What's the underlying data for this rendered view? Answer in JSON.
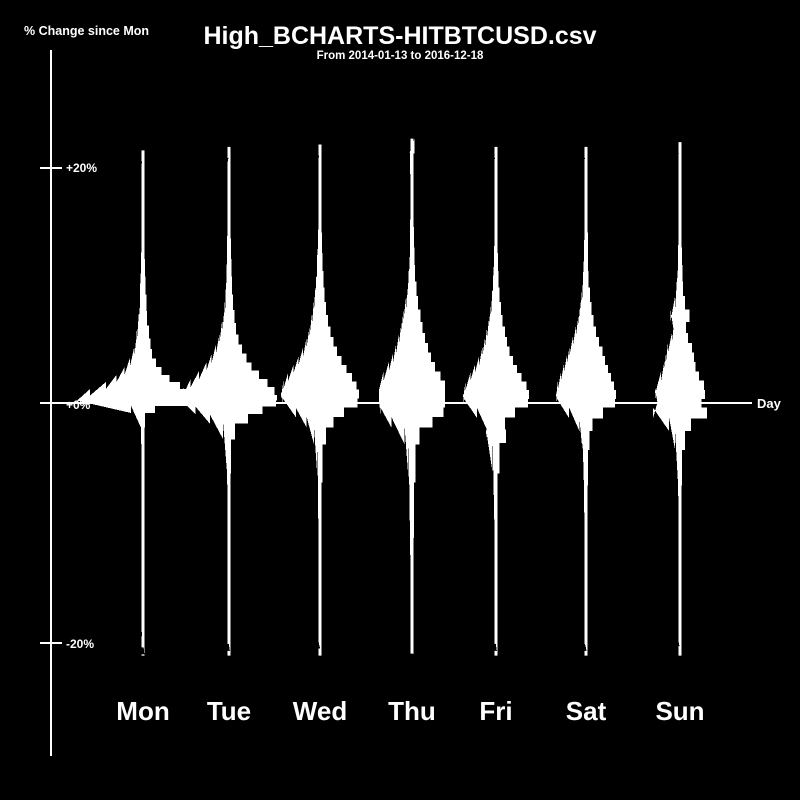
{
  "chart_data": {
    "type": "violin",
    "title": "High_BCHARTS-HITBTCUSD.csv",
    "subtitle": "From 2014-01-13 to 2016-12-18",
    "ylabel": "% Change since Mon",
    "xlabel": "Day",
    "ylim": [
      -24,
      24
    ],
    "yticks": [
      20,
      0,
      -20
    ],
    "ytick_labels": [
      "+20%",
      "+0%",
      "-20%"
    ],
    "grid": false,
    "legend": null,
    "background_color": "#000000",
    "foreground_color": "#ffffff",
    "categories": [
      "Mon",
      "Tue",
      "Wed",
      "Thu",
      "Fri",
      "Sat",
      "Sun"
    ],
    "series": [
      {
        "name": "Mon",
        "center_x": 143,
        "whisker_top": 21.5,
        "whisker_bottom": -21.5,
        "median": 0.0,
        "max_halfwidth_pct": 11.0,
        "density": [
          {
            "v": 21.5,
            "w": 0.02
          },
          {
            "v": 19.0,
            "w": 0.02
          },
          {
            "v": 17.0,
            "w": 0.02
          },
          {
            "v": 15.0,
            "w": 0.02
          },
          {
            "v": 13.0,
            "w": 0.02
          },
          {
            "v": 11.5,
            "w": 0.03
          },
          {
            "v": 10.0,
            "w": 0.04
          },
          {
            "v": 8.5,
            "w": 0.05
          },
          {
            "v": 7.2,
            "w": 0.06
          },
          {
            "v": 6.0,
            "w": 0.09
          },
          {
            "v": 5.0,
            "w": 0.11
          },
          {
            "v": 4.2,
            "w": 0.14
          },
          {
            "v": 3.4,
            "w": 0.2
          },
          {
            "v": 2.7,
            "w": 0.28
          },
          {
            "v": 2.1,
            "w": 0.4
          },
          {
            "v": 1.5,
            "w": 0.56
          },
          {
            "v": 0.9,
            "w": 0.8
          },
          {
            "v": 0.4,
            "w": 1.0
          },
          {
            "v": 0.0,
            "w": 1.0
          },
          {
            "v": -0.5,
            "w": 0.18
          },
          {
            "v": -1.2,
            "w": 0.03
          },
          {
            "v": -3.0,
            "w": 0.02
          },
          {
            "v": -7.0,
            "w": 0.02
          },
          {
            "v": -12.0,
            "w": 0.02
          },
          {
            "v": -17.0,
            "w": 0.02
          },
          {
            "v": -21.5,
            "w": 0.02
          }
        ]
      },
      {
        "name": "Tue",
        "center_x": 229,
        "whisker_top": 21.8,
        "whisker_bottom": -21.5,
        "median": 0.3,
        "max_halfwidth_pct": 8.0,
        "density": [
          {
            "v": 21.8,
            "w": 0.03
          },
          {
            "v": 19.0,
            "w": 0.03
          },
          {
            "v": 17.0,
            "w": 0.03
          },
          {
            "v": 15.0,
            "w": 0.03
          },
          {
            "v": 13.0,
            "w": 0.04
          },
          {
            "v": 11.5,
            "w": 0.05
          },
          {
            "v": 10.0,
            "w": 0.06
          },
          {
            "v": 8.5,
            "w": 0.08
          },
          {
            "v": 7.3,
            "w": 0.11
          },
          {
            "v": 6.3,
            "w": 0.15
          },
          {
            "v": 5.4,
            "w": 0.2
          },
          {
            "v": 4.6,
            "w": 0.27
          },
          {
            "v": 3.8,
            "w": 0.36
          },
          {
            "v": 3.1,
            "w": 0.47
          },
          {
            "v": 2.4,
            "w": 0.62
          },
          {
            "v": 1.7,
            "w": 0.8
          },
          {
            "v": 1.0,
            "w": 0.95
          },
          {
            "v": 0.4,
            "w": 1.0
          },
          {
            "v": 0.0,
            "w": 0.98
          },
          {
            "v": -0.6,
            "w": 0.7
          },
          {
            "v": -1.3,
            "w": 0.4
          },
          {
            "v": -2.2,
            "w": 0.12
          },
          {
            "v": -4.0,
            "w": 0.04
          },
          {
            "v": -8.0,
            "w": 0.03
          },
          {
            "v": -13.0,
            "w": 0.03
          },
          {
            "v": -18.0,
            "w": 0.03
          },
          {
            "v": -21.5,
            "w": 0.03
          }
        ]
      },
      {
        "name": "Wed",
        "center_x": 320,
        "whisker_top": 22.0,
        "whisker_bottom": -21.5,
        "median": 0.2,
        "max_halfwidth_pct": 6.5,
        "density": [
          {
            "v": 22.0,
            "w": 0.04
          },
          {
            "v": 19.5,
            "w": 0.04
          },
          {
            "v": 17.5,
            "w": 0.04
          },
          {
            "v": 15.5,
            "w": 0.04
          },
          {
            "v": 13.5,
            "w": 0.05
          },
          {
            "v": 12.0,
            "w": 0.07
          },
          {
            "v": 10.5,
            "w": 0.09
          },
          {
            "v": 9.2,
            "w": 0.12
          },
          {
            "v": 8.0,
            "w": 0.16
          },
          {
            "v": 7.0,
            "w": 0.21
          },
          {
            "v": 6.0,
            "w": 0.27
          },
          {
            "v": 5.2,
            "w": 0.34
          },
          {
            "v": 4.4,
            "w": 0.43
          },
          {
            "v": 3.6,
            "w": 0.55
          },
          {
            "v": 2.9,
            "w": 0.68
          },
          {
            "v": 2.2,
            "w": 0.82
          },
          {
            "v": 1.5,
            "w": 0.94
          },
          {
            "v": 0.8,
            "w": 1.0
          },
          {
            "v": 0.0,
            "w": 0.96
          },
          {
            "v": -0.8,
            "w": 0.62
          },
          {
            "v": -1.6,
            "w": 0.34
          },
          {
            "v": -2.6,
            "w": 0.15
          },
          {
            "v": -4.5,
            "w": 0.06
          },
          {
            "v": -9.0,
            "w": 0.04
          },
          {
            "v": -14.0,
            "w": 0.04
          },
          {
            "v": -19.0,
            "w": 0.04
          },
          {
            "v": -21.5,
            "w": 0.04
          }
        ]
      },
      {
        "name": "Thu",
        "center_x": 412,
        "whisker_top": 22.5,
        "whisker_bottom": -21.5,
        "median": 0.0,
        "max_halfwidth_pct": 5.5,
        "density": [
          {
            "v": 22.5,
            "w": 0.08
          },
          {
            "v": 20.0,
            "w": 0.05
          },
          {
            "v": 18.0,
            "w": 0.05
          },
          {
            "v": 16.0,
            "w": 0.05
          },
          {
            "v": 14.0,
            "w": 0.06
          },
          {
            "v": 12.5,
            "w": 0.07
          },
          {
            "v": 11.0,
            "w": 0.09
          },
          {
            "v": 9.7,
            "w": 0.13
          },
          {
            "v": 8.5,
            "w": 0.18
          },
          {
            "v": 7.4,
            "w": 0.26
          },
          {
            "v": 6.4,
            "w": 0.32
          },
          {
            "v": 5.5,
            "w": 0.39
          },
          {
            "v": 4.7,
            "w": 0.48
          },
          {
            "v": 3.9,
            "w": 0.57
          },
          {
            "v": 3.1,
            "w": 0.7
          },
          {
            "v": 2.3,
            "w": 0.86
          },
          {
            "v": 1.5,
            "w": 1.0
          },
          {
            "v": 0.7,
            "w": 1.0
          },
          {
            "v": 0.0,
            "w": 1.0
          },
          {
            "v": -0.8,
            "w": 0.95
          },
          {
            "v": -1.6,
            "w": 0.62
          },
          {
            "v": -2.6,
            "w": 0.22
          },
          {
            "v": -4.5,
            "w": 0.1
          },
          {
            "v": -9.0,
            "w": 0.06
          },
          {
            "v": -14.0,
            "w": 0.05
          },
          {
            "v": -19.0,
            "w": 0.05
          },
          {
            "v": -21.5,
            "w": 0.05
          }
        ]
      },
      {
        "name": "Fri",
        "center_x": 496,
        "whisker_top": 21.8,
        "whisker_bottom": -21.5,
        "median": 0.1,
        "max_halfwidth_pct": 5.5,
        "density": [
          {
            "v": 21.8,
            "w": 0.04
          },
          {
            "v": 19.5,
            "w": 0.04
          },
          {
            "v": 17.5,
            "w": 0.04
          },
          {
            "v": 15.5,
            "w": 0.04
          },
          {
            "v": 13.5,
            "w": 0.05
          },
          {
            "v": 12.0,
            "w": 0.06
          },
          {
            "v": 10.5,
            "w": 0.08
          },
          {
            "v": 9.2,
            "w": 0.11
          },
          {
            "v": 8.0,
            "w": 0.15
          },
          {
            "v": 7.0,
            "w": 0.2
          },
          {
            "v": 6.0,
            "w": 0.27
          },
          {
            "v": 5.2,
            "w": 0.33
          },
          {
            "v": 4.4,
            "w": 0.41
          },
          {
            "v": 3.6,
            "w": 0.51
          },
          {
            "v": 2.9,
            "w": 0.64
          },
          {
            "v": 2.2,
            "w": 0.78
          },
          {
            "v": 1.5,
            "w": 0.92
          },
          {
            "v": 0.7,
            "w": 1.0
          },
          {
            "v": 0.0,
            "w": 0.97
          },
          {
            "v": -0.8,
            "w": 0.58
          },
          {
            "v": -1.7,
            "w": 0.28
          },
          {
            "v": -2.8,
            "w": 0.3
          },
          {
            "v": -4.0,
            "w": 0.1
          },
          {
            "v": -8.0,
            "w": 0.05
          },
          {
            "v": -13.0,
            "w": 0.04
          },
          {
            "v": -18.0,
            "w": 0.04
          },
          {
            "v": -21.5,
            "w": 0.04
          }
        ]
      },
      {
        "name": "Sat",
        "center_x": 586,
        "whisker_top": 21.8,
        "whisker_bottom": -21.5,
        "median": 0.0,
        "max_halfwidth_pct": 5.0,
        "density": [
          {
            "v": 21.8,
            "w": 0.04
          },
          {
            "v": 19.5,
            "w": 0.04
          },
          {
            "v": 17.5,
            "w": 0.05
          },
          {
            "v": 15.5,
            "w": 0.05
          },
          {
            "v": 13.5,
            "w": 0.06
          },
          {
            "v": 12.0,
            "w": 0.07
          },
          {
            "v": 10.5,
            "w": 0.09
          },
          {
            "v": 9.2,
            "w": 0.13
          },
          {
            "v": 8.0,
            "w": 0.19
          },
          {
            "v": 7.0,
            "w": 0.25
          },
          {
            "v": 6.0,
            "w": 0.34
          },
          {
            "v": 5.2,
            "w": 0.44
          },
          {
            "v": 4.4,
            "w": 0.55
          },
          {
            "v": 3.6,
            "w": 0.64
          },
          {
            "v": 2.9,
            "w": 0.74
          },
          {
            "v": 2.2,
            "w": 0.84
          },
          {
            "v": 1.5,
            "w": 0.94
          },
          {
            "v": 0.7,
            "w": 1.0
          },
          {
            "v": 0.0,
            "w": 0.96
          },
          {
            "v": -0.8,
            "w": 0.56
          },
          {
            "v": -1.8,
            "w": 0.22
          },
          {
            "v": -3.0,
            "w": 0.12
          },
          {
            "v": -5.0,
            "w": 0.07
          },
          {
            "v": -9.0,
            "w": 0.05
          },
          {
            "v": -14.0,
            "w": 0.05
          },
          {
            "v": -19.0,
            "w": 0.04
          },
          {
            "v": -21.5,
            "w": 0.04
          }
        ]
      },
      {
        "name": "Sun",
        "center_x": 680,
        "whisker_top": 22.2,
        "whisker_bottom": -21.5,
        "median": -0.3,
        "max_halfwidth_pct": 4.5,
        "density": [
          {
            "v": 22.2,
            "w": 0.05
          },
          {
            "v": 20.0,
            "w": 0.05
          },
          {
            "v": 18.0,
            "w": 0.05
          },
          {
            "v": 16.0,
            "w": 0.05
          },
          {
            "v": 14.0,
            "w": 0.06
          },
          {
            "v": 12.5,
            "w": 0.07
          },
          {
            "v": 11.0,
            "w": 0.09
          },
          {
            "v": 9.7,
            "w": 0.12
          },
          {
            "v": 8.5,
            "w": 0.18
          },
          {
            "v": 7.4,
            "w": 0.35
          },
          {
            "v": 6.4,
            "w": 0.22
          },
          {
            "v": 5.5,
            "w": 0.3
          },
          {
            "v": 4.7,
            "w": 0.45
          },
          {
            "v": 3.9,
            "w": 0.52
          },
          {
            "v": 3.1,
            "w": 0.58
          },
          {
            "v": 2.3,
            "w": 0.7
          },
          {
            "v": 1.5,
            "w": 0.88
          },
          {
            "v": 0.7,
            "w": 0.92
          },
          {
            "v": 0.0,
            "w": 0.8
          },
          {
            "v": -0.8,
            "w": 1.0
          },
          {
            "v": -1.8,
            "w": 0.4
          },
          {
            "v": -3.0,
            "w": 0.18
          },
          {
            "v": -5.0,
            "w": 0.07
          },
          {
            "v": -9.0,
            "w": 0.05
          },
          {
            "v": -14.0,
            "w": 0.05
          },
          {
            "v": -19.0,
            "w": 0.05
          },
          {
            "v": -21.5,
            "w": 0.05
          }
        ]
      }
    ]
  },
  "axis": {
    "y_label_text": "% Change since Mon",
    "x_label_text": "Day",
    "tick_0": "+20%",
    "tick_1": "+0%",
    "tick_2": "-20%"
  },
  "title": {
    "main": "High_BCHARTS-HITBTCUSD.csv",
    "sub": "From 2014-01-13 to 2016-12-18"
  },
  "day_labels": {
    "d0": "Mon",
    "d1": "Tue",
    "d2": "Wed",
    "d3": "Thu",
    "d4": "Fri",
    "d5": "Sat",
    "d6": "Sun"
  }
}
